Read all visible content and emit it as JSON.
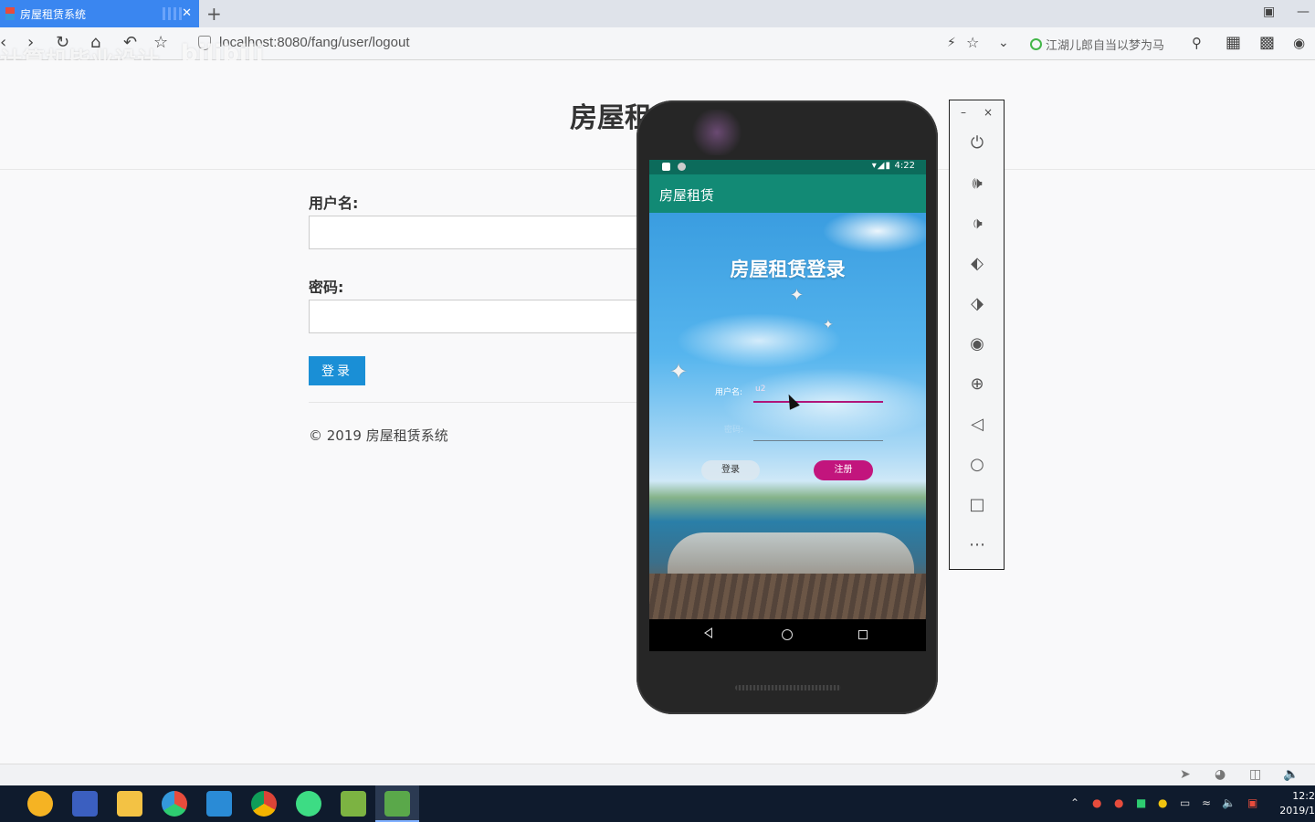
{
  "browser": {
    "tab_title": "房屋租赁系统",
    "tab_close": "✕",
    "new_tab": "+",
    "url": "localhost:8080/fang/user/logout",
    "search_hint": "江湖儿郎自当以梦为马",
    "watermark_left": "计算机毕业设计",
    "watermark_right": "bilibili"
  },
  "page": {
    "title": "房屋租",
    "username_label": "用户名:",
    "username_value": "",
    "password_label": "密码:",
    "password_value": "",
    "login_button": "登录",
    "copyright": "© 2019 房屋租赁系统"
  },
  "emulator": {
    "status_time": "4:22",
    "app_title": "房屋租赁",
    "login_title": "房屋租赁登录",
    "username_label": "用户名:",
    "username_value": "u2",
    "password_label": "密码:",
    "login_button": "登录",
    "register_button": "注册"
  },
  "side_panel": {
    "minimize": "–",
    "close": "×",
    "items": [
      "power-icon",
      "volume-up-icon",
      "volume-down-icon",
      "rotate-left-icon",
      "rotate-right-icon",
      "camera-icon",
      "zoom-icon",
      "back-icon",
      "home-icon",
      "overview-icon",
      "more-icon"
    ]
  },
  "taskbar": {
    "clock_time": "12:2",
    "clock_date": "2019/1"
  },
  "colors": {
    "tab_active": "#3a86f0",
    "login_button": "#1a8fd6",
    "app_bar": "#128a75",
    "register_button": "#c2157d"
  }
}
